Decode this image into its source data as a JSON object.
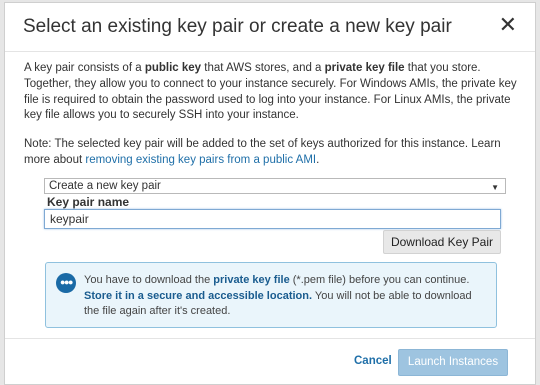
{
  "dialog": {
    "title": "Select an existing key pair or create a new key pair",
    "close_glyph": "✕"
  },
  "intro": {
    "p1": "A key pair consists of a ",
    "p1_bold1": "public key",
    "p2": " that AWS stores, and a ",
    "p2_bold2": "private key file",
    "p3": " that you store. Together, they allow you to connect to your instance securely. For Windows AMIs, the private key file is required to obtain the password used to log into your instance. For Linux AMIs, the private key file allows you to securely SSH into your instance."
  },
  "note": {
    "text": "Note: The selected key pair will be added to the set of keys authorized for this instance. Learn more about ",
    "link": "removing existing key pairs from a public AMI",
    "suffix": "."
  },
  "key_pair_select": {
    "selected": "Create a new key pair"
  },
  "key_pair_name": {
    "label": "Key pair name",
    "value": "keypair"
  },
  "download_button": {
    "label": "Download Key Pair"
  },
  "info_box": {
    "t1": "You have to download the ",
    "b1": "private key file",
    "t2": " (*.pem file) before you can continue. ",
    "b2": "Store it in a secure and accessible location.",
    "t3": " You will not be able to download the file again after it's created."
  },
  "footer": {
    "cancel": "Cancel",
    "launch": "Launch Instances"
  },
  "colors": {
    "accent": "#1f6fa8",
    "info_bg": "#eaf5fb",
    "info_border": "#8fc1de",
    "launch_disabled": "#9ec4e0"
  },
  "icons": {
    "info": "chat-bubble-icon",
    "select_caret": "triangle-down-icon",
    "close": "close-icon"
  }
}
